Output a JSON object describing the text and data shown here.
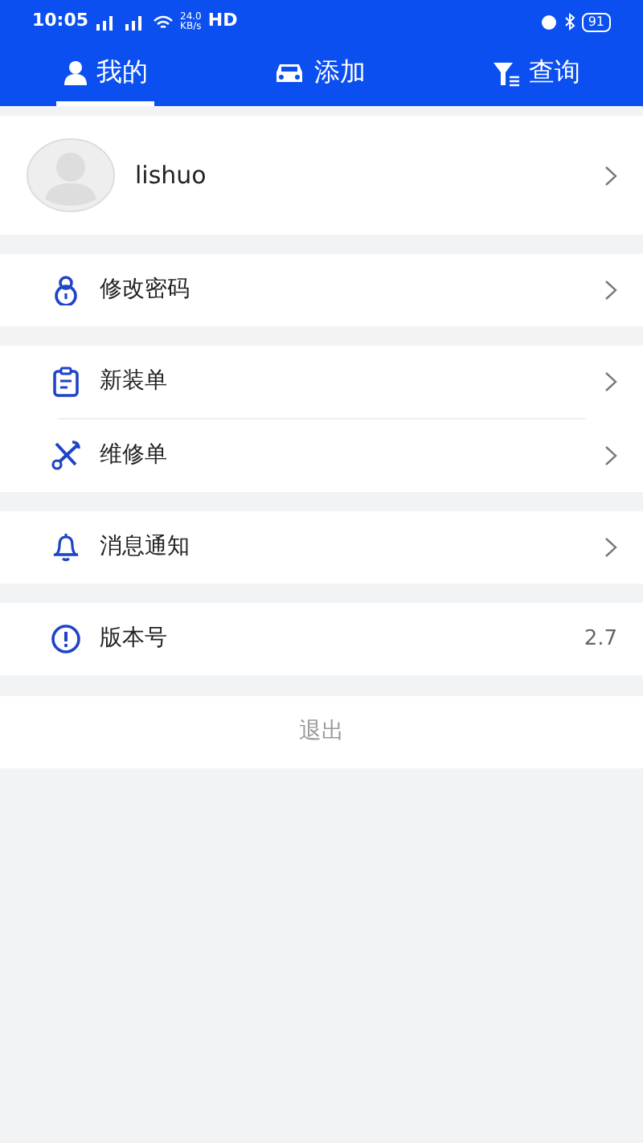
{
  "status_bar": {
    "time": "10:05",
    "speed_value": "24.0",
    "speed_unit": "KB/s",
    "hd": "HD",
    "battery": "91"
  },
  "tabs": [
    {
      "label": "我的",
      "selected": true
    },
    {
      "label": "添加",
      "selected": false
    },
    {
      "label": "查询",
      "selected": false
    }
  ],
  "profile": {
    "username": "lishuo"
  },
  "groups": [
    [
      {
        "label": "修改密码",
        "kind": "link"
      }
    ],
    [
      {
        "label": "新装单",
        "kind": "link"
      },
      {
        "label": "维修单",
        "kind": "link"
      }
    ],
    [
      {
        "label": "消息通知",
        "kind": "link"
      }
    ],
    [
      {
        "label": "版本号",
        "kind": "value",
        "value": "2.7"
      }
    ]
  ],
  "logout": "退出"
}
